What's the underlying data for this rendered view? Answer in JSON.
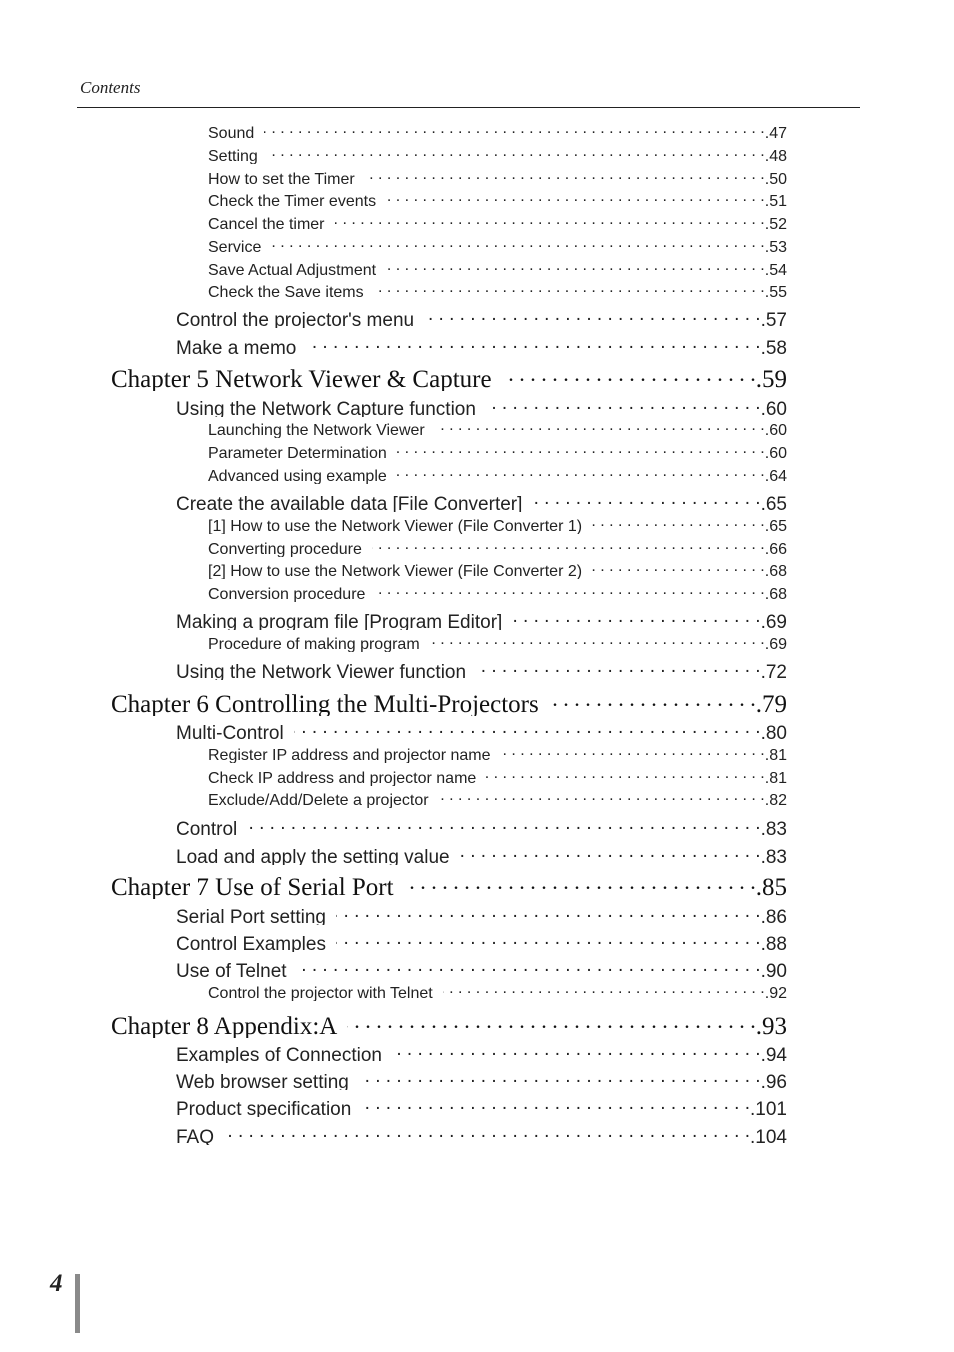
{
  "header": {
    "title": "Contents"
  },
  "footer": {
    "page_number": "4"
  },
  "toc": [
    {
      "level": "sub",
      "label": "Sound",
      "page": ".47"
    },
    {
      "level": "sub",
      "label": "Setting",
      "page": ".48"
    },
    {
      "level": "sub",
      "label": "How to set the Timer",
      "page": ".50"
    },
    {
      "level": "sub",
      "label": "Check the Timer events",
      "page": ".51"
    },
    {
      "level": "sub",
      "label": "Cancel the timer",
      "page": ".52"
    },
    {
      "level": "sub",
      "label": "Service",
      "page": ".53"
    },
    {
      "level": "sub",
      "label": "Save Actual Adjustment",
      "page": ".54"
    },
    {
      "level": "sub",
      "label": "Check the Save items",
      "page": ".55"
    },
    {
      "level": "section",
      "label": "Control the projector's menu",
      "page": ".57"
    },
    {
      "level": "section",
      "label": "Make a memo",
      "page": ".58"
    },
    {
      "level": "chapter",
      "label": "Chapter 5 Network Viewer & Capture",
      "page": ".59"
    },
    {
      "level": "section",
      "label": "Using the Network Capture function",
      "page": ".60"
    },
    {
      "level": "sub",
      "label": "Launching the Network Viewer",
      "page": ".60"
    },
    {
      "level": "sub",
      "label": "Parameter Determination",
      "page": ".60"
    },
    {
      "level": "sub",
      "label": "Advanced using example",
      "page": ".64"
    },
    {
      "level": "section",
      "label": "Create the available data [File Converter]",
      "page": ".65"
    },
    {
      "level": "sub",
      "label": "[1] How to use the Network Viewer (File Converter 1)",
      "page": ".65"
    },
    {
      "level": "sub",
      "label": "Converting procedure",
      "page": ".66"
    },
    {
      "level": "sub",
      "label": "[2] How to use the Network Viewer (File Converter 2)",
      "page": ".68"
    },
    {
      "level": "sub",
      "label": "Conversion procedure",
      "page": ".68"
    },
    {
      "level": "section",
      "label": "Making a program file [Program Editor]",
      "page": ".69"
    },
    {
      "level": "sub",
      "label": "Procedure of making program",
      "page": ".69"
    },
    {
      "level": "section",
      "label": "Using the Network Viewer function",
      "page": ".72"
    },
    {
      "level": "chapter",
      "label": "Chapter 6 Controlling the Multi-Projectors",
      "page": ".79"
    },
    {
      "level": "section",
      "label": "Multi-Control",
      "page": ".80"
    },
    {
      "level": "sub",
      "label": "Register IP address and projector name",
      "page": ".81"
    },
    {
      "level": "sub",
      "label": "Check IP address and projector name",
      "page": ".81"
    },
    {
      "level": "sub",
      "label": "Exclude/Add/Delete a projector",
      "page": ".82"
    },
    {
      "level": "section",
      "label": "Control",
      "page": ".83"
    },
    {
      "level": "section",
      "label": "Load and apply the setting value",
      "page": ".83"
    },
    {
      "level": "chapter",
      "label": "Chapter 7 Use of Serial Port",
      "page": ".85"
    },
    {
      "level": "section",
      "label": "Serial Port setting",
      "page": ".86"
    },
    {
      "level": "section",
      "label": "Control Examples",
      "page": ".88"
    },
    {
      "level": "section",
      "label": "Use of Telnet",
      "page": ".90"
    },
    {
      "level": "sub",
      "label": "Control the projector with Telnet",
      "page": ".92"
    },
    {
      "level": "chapter",
      "label": "Chapter 8 Appendix:A",
      "page": ".93"
    },
    {
      "level": "section",
      "label": "Examples of Connection",
      "page": ".94"
    },
    {
      "level": "section",
      "label": "Web browser setting",
      "page": ".96"
    },
    {
      "level": "section",
      "label": "Product specification",
      "page": ".101"
    },
    {
      "level": "section",
      "label": "FAQ",
      "page": ".104"
    }
  ]
}
